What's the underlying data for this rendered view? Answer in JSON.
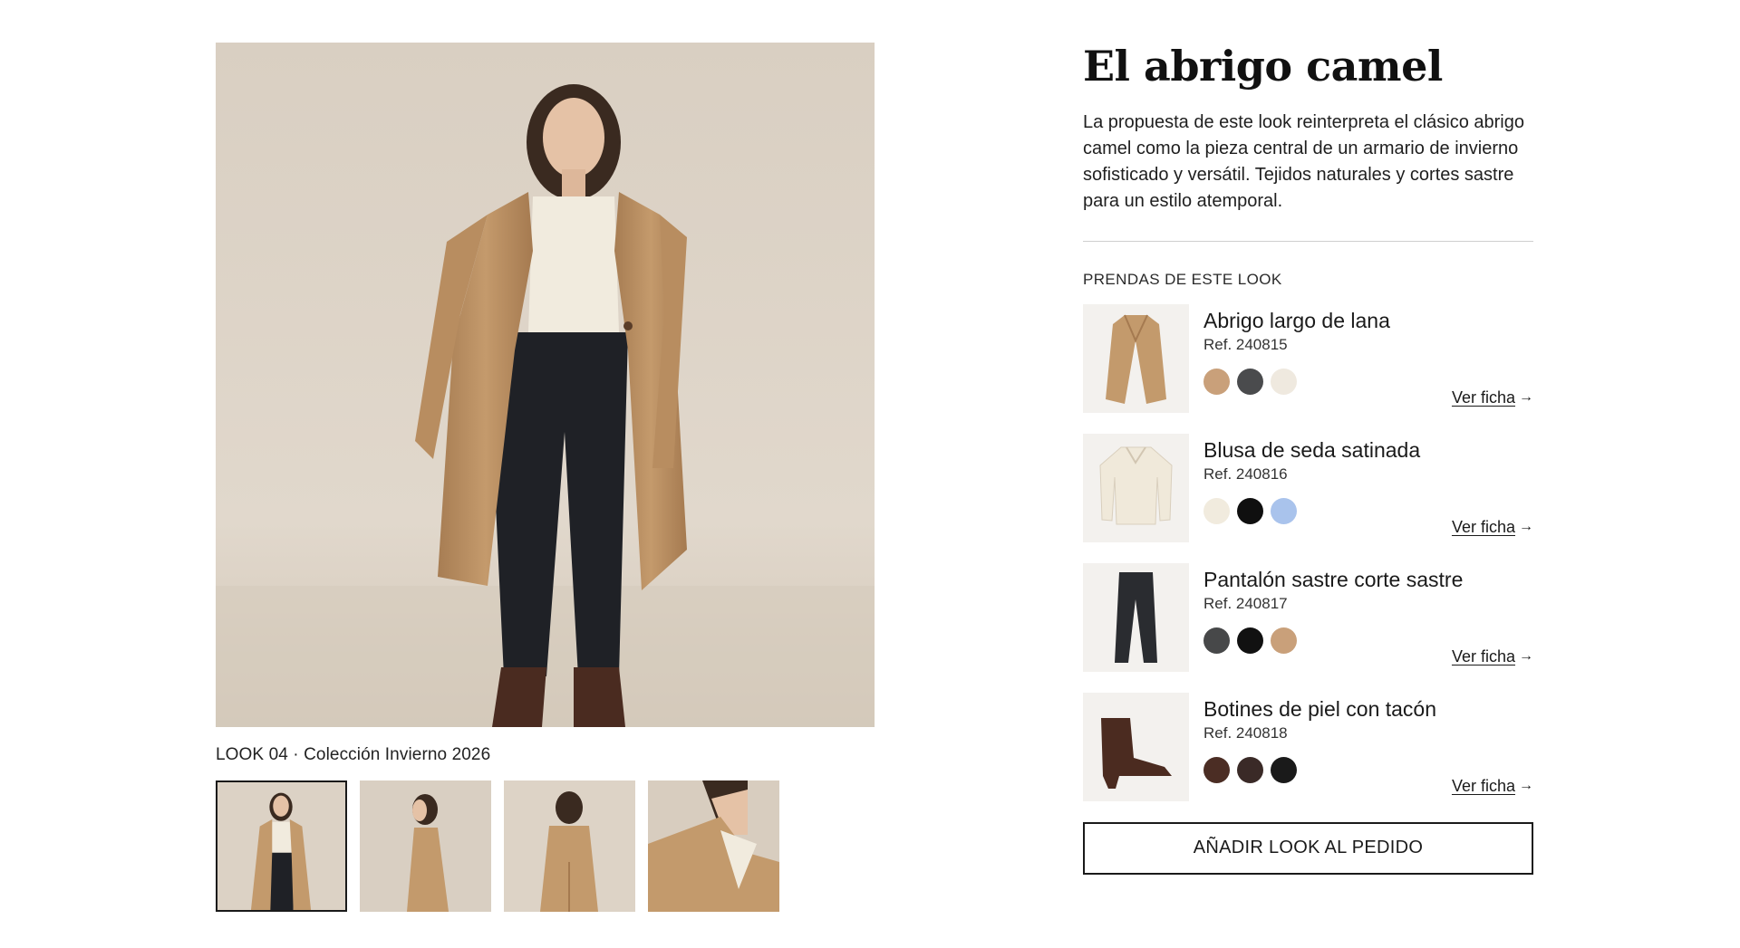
{
  "gallery": {
    "hero_alt": "look-photo",
    "caption": "LOOK 04 · Colección Invierno 2026",
    "thumbnails": [
      "front",
      "side",
      "back",
      "detail"
    ],
    "active_thumbnail": 0
  },
  "details": {
    "title": "El abrigo camel",
    "description": "La propuesta de este look reinterpreta el clásico abrigo camel como la pieza central de un armario de invierno sofisticado y versátil. Tejidos naturales y cortes sastre para un estilo atemporal.",
    "section_label": "PRENDAS DE ESTE LOOK",
    "items": [
      {
        "name": "Abrigo largo de lana",
        "ref": "Ref. 240815",
        "icon": "coat",
        "swatches": [
          "#c9a07a",
          "#4a4b4d",
          "#efe9df"
        ],
        "link": "Ver ficha"
      },
      {
        "name": "Blusa de seda satinada",
        "ref": "Ref. 240816",
        "icon": "blouse",
        "swatches": [
          "#f1ebde",
          "#0f0f0f",
          "#a9c3ec"
        ],
        "link": "Ver ficha"
      },
      {
        "name": "Pantalón sastre corte sastre",
        "ref": "Ref. 240817",
        "icon": "trousers",
        "swatches": [
          "#474849",
          "#111111",
          "#c9a07a"
        ],
        "link": "Ver ficha"
      },
      {
        "name": "Botines de piel con tacón",
        "ref": "Ref. 240818",
        "icon": "ankle-boot",
        "swatches": [
          "#4b2d24",
          "#3a2a27",
          "#1a1a1a"
        ],
        "link": "Ver ficha"
      }
    ],
    "cta_label": "AÑADIR LOOK AL PEDIDO"
  },
  "colors": {
    "camel": "#c39a6e",
    "ink": "#1a1a1a",
    "background": "#ffffff"
  }
}
